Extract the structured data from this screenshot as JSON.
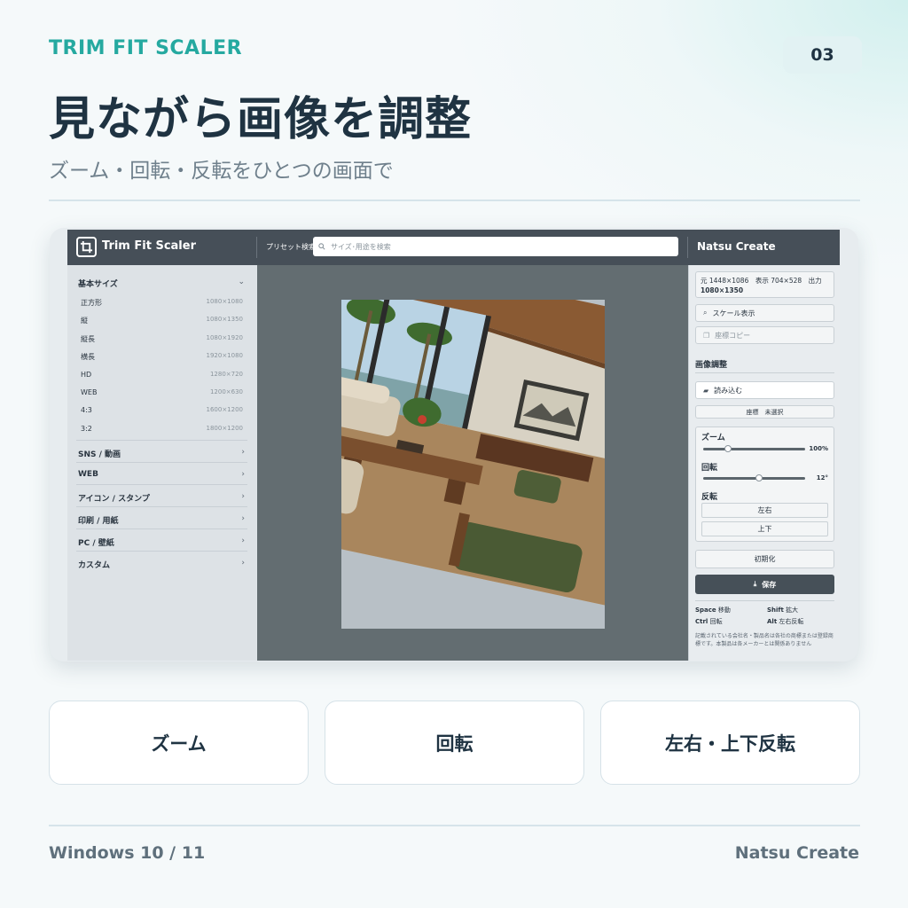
{
  "header": {
    "brand": "TRIM FIT SCALER",
    "page_number": "03",
    "headline": "見ながら画像を調整",
    "subheadline": "ズーム・回転・反転をひとつの画面で"
  },
  "app": {
    "title": "Trim Fit Scaler",
    "preset_search_label": "プリセット検索",
    "search_placeholder": "サイズ･用途を検索",
    "brand_right": "Natsu Create",
    "sidebar": {
      "basic_category": "基本サイズ",
      "basic_items": [
        {
          "name": "正方形",
          "size": "1080×1080"
        },
        {
          "name": "縦",
          "size": "1080×1350"
        },
        {
          "name": "縦長",
          "size": "1080×1920"
        },
        {
          "name": "横長",
          "size": "1920×1080"
        },
        {
          "name": "HD",
          "size": "1280×720"
        },
        {
          "name": "WEB",
          "size": "1200×630"
        },
        {
          "name": "4:3",
          "size": "1600×1200"
        },
        {
          "name": "3:2",
          "size": "1800×1200"
        }
      ],
      "categories": [
        "SNS / 動画",
        "WEB",
        "アイコン / スタンプ",
        "印刷 / 用紙",
        "PC / 壁紙",
        "カスタム"
      ]
    },
    "panel": {
      "info_line1": "元 1448×1086　表示 704×528　出力",
      "info_line2": "1080×1350",
      "scale_view": "スケール表示",
      "copy_coords": "座標コピー",
      "image_adjust_title": "画像調整",
      "load": "読み込む",
      "coords_status": "座標　未選択",
      "zoom_label": "ズーム",
      "zoom_value": "100%",
      "zoom_fraction": 0.22,
      "rotate_label": "回転",
      "rotate_value": "12°",
      "rotate_fraction": 0.55,
      "flip_label": "反転",
      "flip_horizontal": "左右",
      "flip_vertical": "上下",
      "reset": "初期化",
      "save": "保存",
      "shortcuts": [
        {
          "key": "Space",
          "action": "移動"
        },
        {
          "key": "Shift",
          "action": "拡大"
        },
        {
          "key": "Ctrl",
          "action": "回転"
        },
        {
          "key": "Alt",
          "action": "左右反転"
        }
      ],
      "notice": "記載されている会社名・製品名は各社の商標または登録商標です。本製品は各メーカーとは関係ありません"
    }
  },
  "features": [
    "ズーム",
    "回転",
    "左右・上下反転"
  ],
  "footer": {
    "os": "Windows 10 / 11",
    "brand": "Natsu Create"
  },
  "colors": {
    "accent": "#25a9a0",
    "titlebar": "#464f58",
    "canvas": "#636d71",
    "save_button": "#465058"
  }
}
